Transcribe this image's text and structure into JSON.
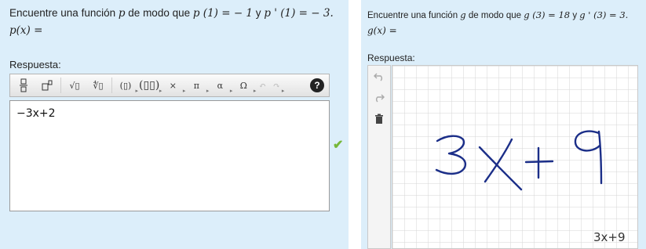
{
  "left": {
    "question_prefix": "Encuentre una función",
    "func_var": "p",
    "question_mid": "de modo que",
    "cond1": "p (1) = − 1",
    "conj": "y",
    "cond2": "p ' (1) = − 3.",
    "answer_prompt": "p(x) =",
    "response_label": "Respuesta:",
    "toolbar": {
      "fraction_icon": "fraction-icon",
      "superscript_icon": "superscript-icon",
      "sqrt_label": "√▯",
      "nthroot_label": "∜▯",
      "paren_label": "(▯)",
      "matrix_label": "(▯▯)",
      "times_label": "×",
      "pi_label": "π",
      "alpha_label": "α",
      "omega_label": "Ω",
      "undo_label": "↶",
      "redo_label": "↷",
      "help_label": "?"
    },
    "answer_value": "−3x+2",
    "status": "correct",
    "accent_color": "#77b83a"
  },
  "right": {
    "question_prefix": "Encuentre una función",
    "func_var": "g",
    "question_mid": "de modo que",
    "cond1": "g (3) = 18",
    "conj": "y",
    "cond2": "g ' (3) = 3.",
    "answer_prompt": "g(x) =",
    "response_label": "Respuesta:",
    "tools": [
      "undo-icon",
      "redo-icon",
      "trash-icon"
    ],
    "handwriting_recognized": "3x+9"
  }
}
